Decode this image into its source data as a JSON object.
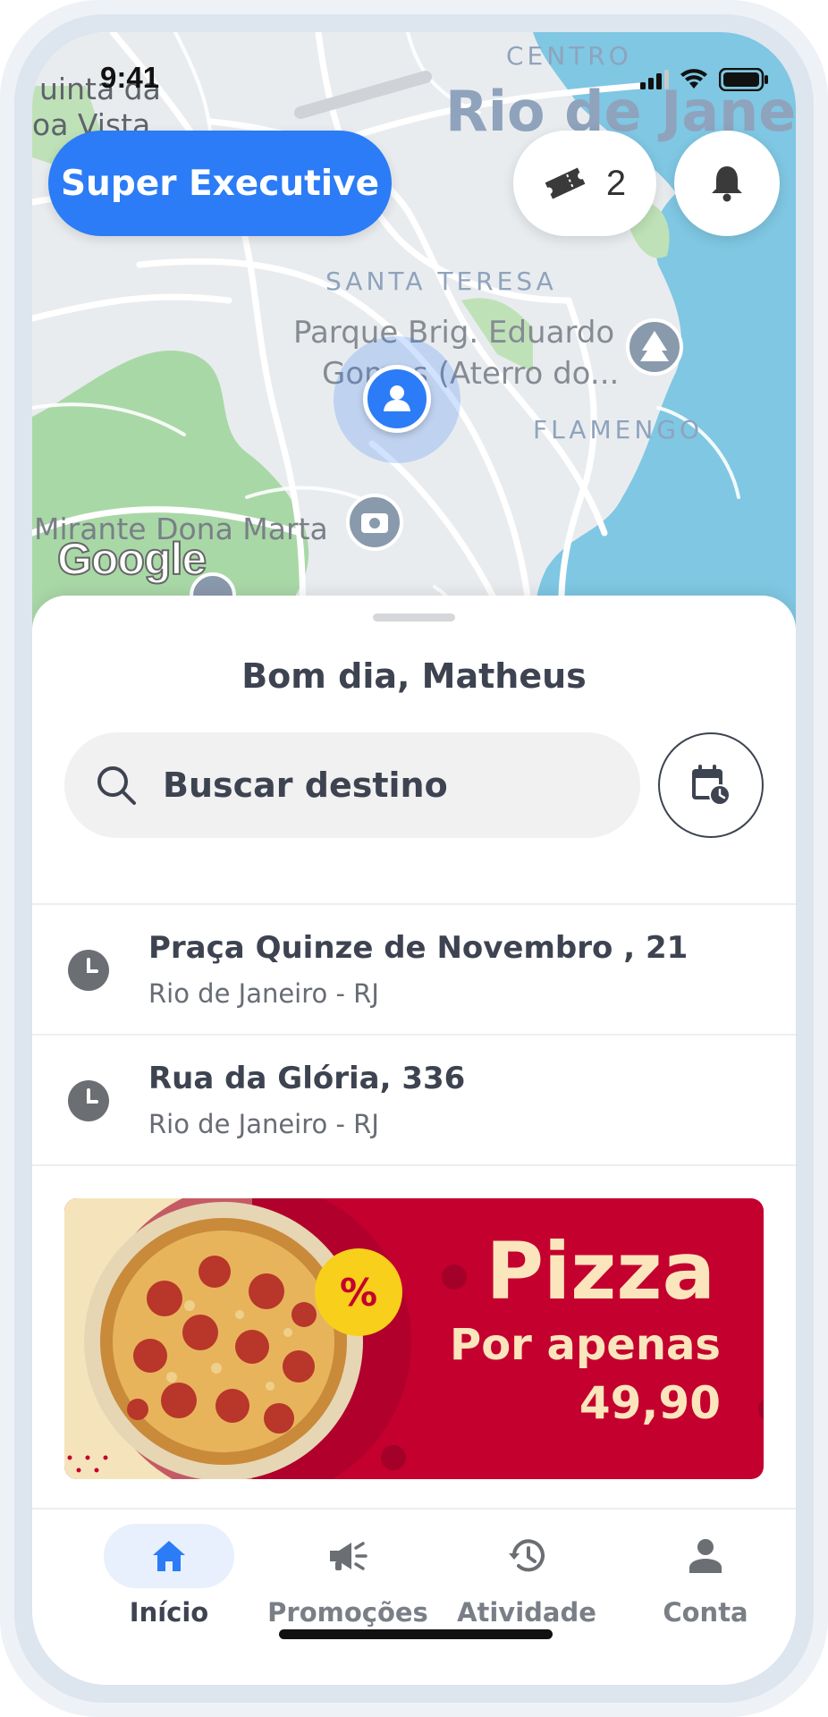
{
  "status_bar": {
    "time": "9:41"
  },
  "map": {
    "labels": {
      "centro": "CENTRO",
      "city": "Rio de Janei",
      "santa_teresa": "SANTA TERESA",
      "park_line1": "Parque Brig. Eduardo",
      "park_line2": "Gomes (Aterro do...",
      "flamengo": "FLAMENGO",
      "mirante": "Mirante Dona Marta",
      "top_left_1": "uinta da",
      "top_left_2": "oa Vista"
    },
    "attribution": "Google"
  },
  "header": {
    "service_label": "Super Executive",
    "ticket_count": "2"
  },
  "sheet": {
    "greeting": "Bom dia, Matheus",
    "search": {
      "placeholder": "Buscar destino"
    },
    "recent": [
      {
        "title": "Praça Quinze de Novembro , 21",
        "subtitle": "Rio de Janeiro - RJ"
      },
      {
        "title": "Rua da Glória, 336",
        "subtitle": "Rio de Janeiro - RJ"
      }
    ]
  },
  "promo": {
    "title": "Pizza",
    "line": "Por apenas",
    "price": "49,90",
    "badge": "%"
  },
  "nav": {
    "items": [
      {
        "label": "Início",
        "icon": "home-icon",
        "active": true
      },
      {
        "label": "Promoções",
        "icon": "megaphone-icon"
      },
      {
        "label": "Atividade",
        "icon": "history-icon"
      },
      {
        "label": "Conta",
        "icon": "person-icon"
      }
    ]
  },
  "colors": {
    "accent": "#2b7cf6",
    "promo_red": "#c4002f",
    "promo_cream": "#fbe5bd",
    "badge_yellow": "#f8cf1a",
    "water": "#7fc7e3",
    "park": "#a9d8a7"
  }
}
